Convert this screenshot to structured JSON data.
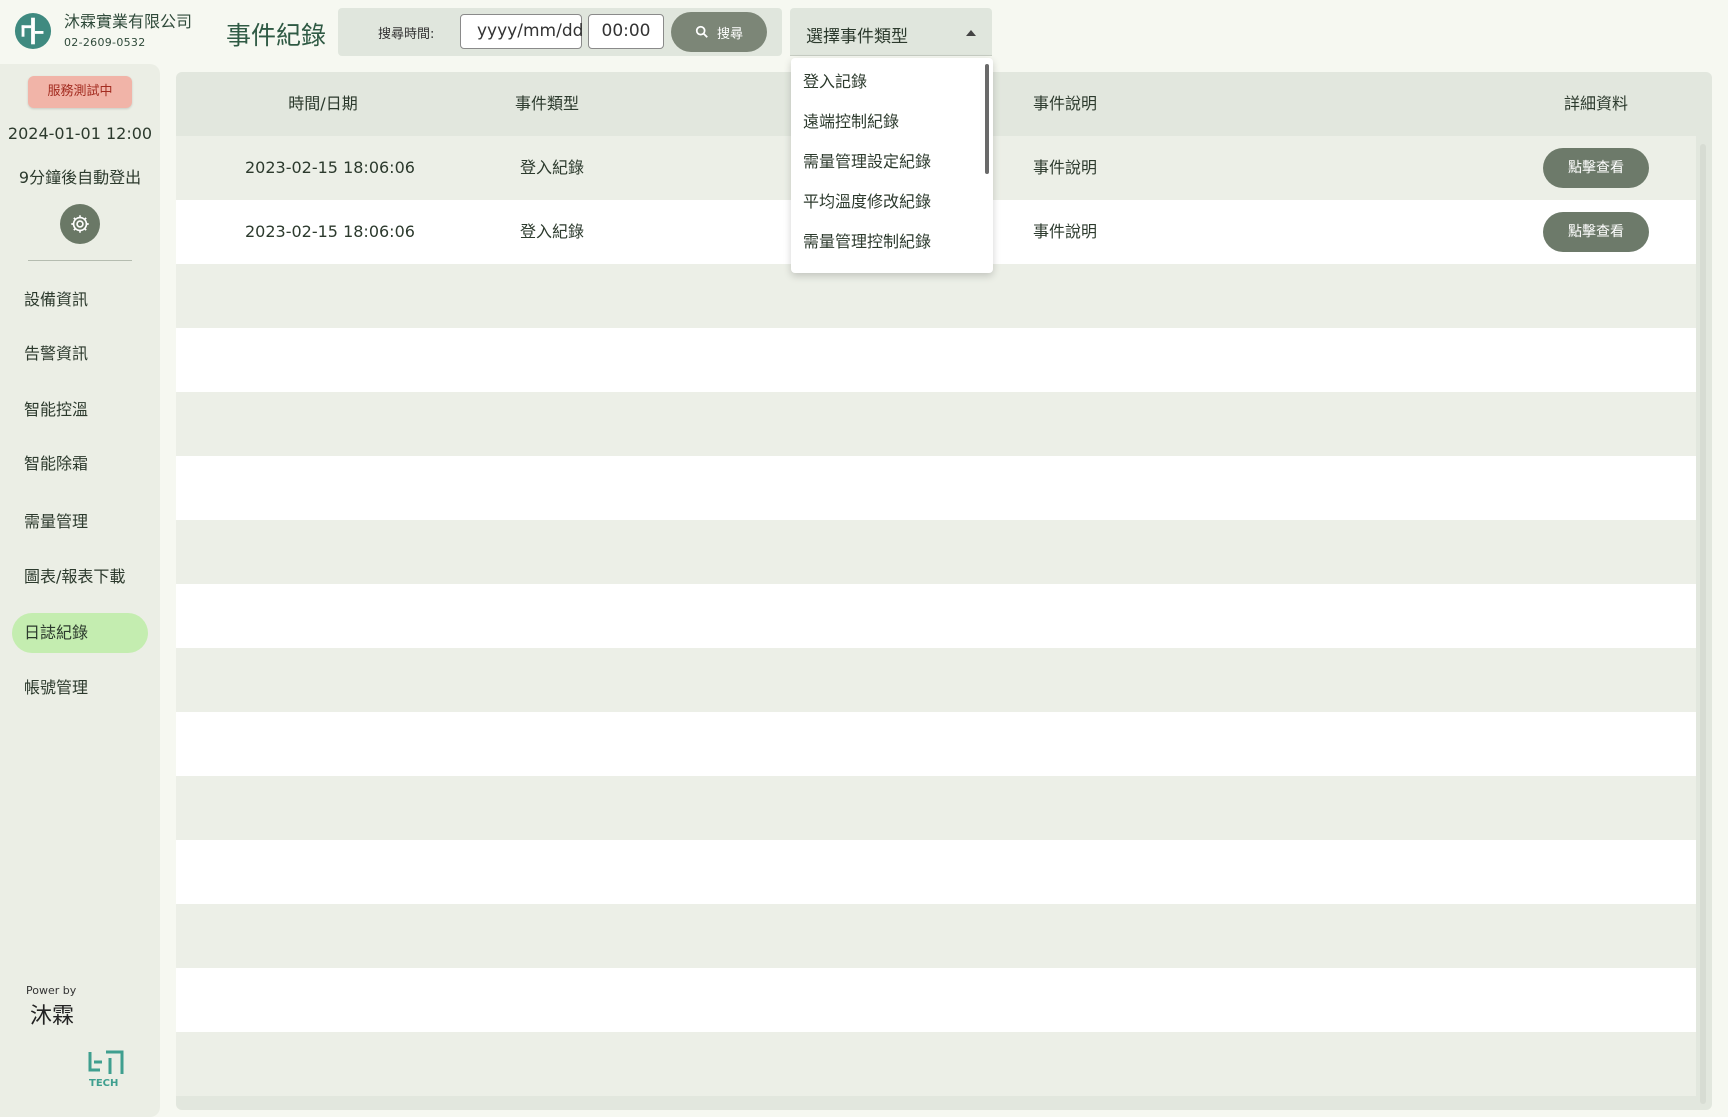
{
  "header": {
    "company_name": "沐霖實業有限公司",
    "company_phone": "02-2609-0532",
    "page_title": "事件紀錄",
    "search_label": "搜尋時間:",
    "date_placeholder": "yyyy/mm/dd",
    "time_value": "00:00",
    "search_button": "搜尋",
    "event_type_select": "選擇事件類型"
  },
  "dropdown": {
    "options": [
      "登入記錄",
      "遠端控制紀錄",
      "需量管理設定紀錄",
      "平均溫度修改紀錄",
      "需量管理控制紀錄"
    ]
  },
  "sidebar": {
    "badge": "服務測試中",
    "datetime": "2024-01-01 12:00",
    "logout_notice": "9分鐘後自動登出",
    "items": [
      {
        "label": "設備資訊"
      },
      {
        "label": "告警資訊"
      },
      {
        "label": "智能控溫"
      },
      {
        "label": "智能除霜"
      },
      {
        "label": "需量管理"
      },
      {
        "label": "圖表/報表下載"
      },
      {
        "label": "日誌紀錄",
        "active": true
      },
      {
        "label": "帳號管理"
      }
    ],
    "power_by": "Power by",
    "brand": "沐霖"
  },
  "table": {
    "columns": [
      "時間/日期",
      "事件類型",
      "事件說明",
      "詳細資料"
    ],
    "rows": [
      {
        "time": "2023-02-15 18:06:06",
        "type": "登入紀錄",
        "description": "事件說明",
        "action": "點擊查看"
      },
      {
        "time": "2023-02-15 18:06:06",
        "type": "登入紀錄",
        "description": "事件說明",
        "action": "點擊查看"
      }
    ]
  },
  "colors": {
    "accent": "#2f5a44",
    "active_nav": "#c4edb0",
    "badge_bg": "#f1b4a8",
    "button": "#6d7a6a"
  },
  "icons": {
    "logo": "company-logo-icon",
    "search": "search-icon",
    "settings": "gear-icon",
    "dropdown": "caret-up-icon"
  }
}
